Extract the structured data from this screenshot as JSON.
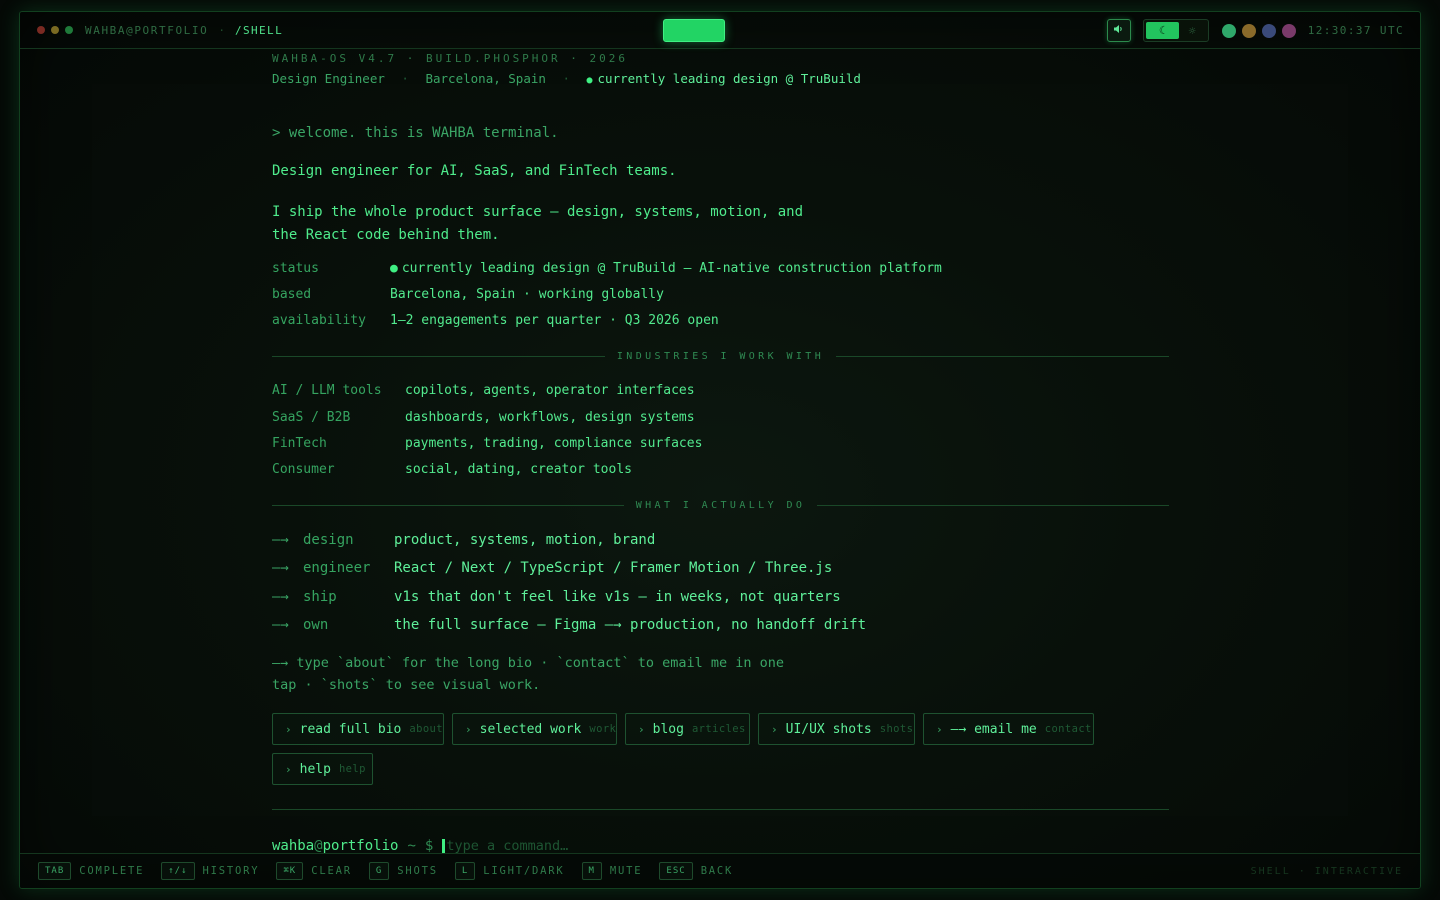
{
  "topbar": {
    "host": "WAHBA@PORTFOLIO",
    "separator": "·",
    "path": "/SHELL",
    "sound_icon": "speaker-icon",
    "theme_dark_icon": "moon-icon",
    "theme_light_icon": "sun-icon",
    "swatches": [
      "#2fa86a",
      "#8a6a2a",
      "#3a4a7a",
      "#7a3a6a"
    ],
    "clock": "12:30:37 UTC"
  },
  "header": {
    "banner": "WAHBA-OS V4.7 · BUILD.PHOSPHOR · 2026",
    "role": "Design Engineer",
    "dot1": "·",
    "location": "Barcelona, Spain",
    "dot2": "·",
    "status_bullet": "●",
    "status": "currently leading design @ TruBuild"
  },
  "intro": {
    "welcome": "> welcome. this is WAHBA terminal.",
    "headline": "Design engineer for AI, SaaS, and FinTech teams.",
    "pitch": "I ship the whole product surface — design, systems, motion, and the React code behind them."
  },
  "facts": [
    {
      "key": "status",
      "bullet": "●",
      "value": "currently leading design @ TruBuild — AI-native construction platform"
    },
    {
      "key": "based",
      "bullet": "",
      "value": "Barcelona, Spain · working globally"
    },
    {
      "key": "availability",
      "bullet": "",
      "value": "1–2 engagements per quarter · Q3 2026 open"
    }
  ],
  "industries": {
    "title": "INDUSTRIES I WORK WITH",
    "items": [
      {
        "key": "AI / LLM tools",
        "value": "copilots, agents, operator interfaces"
      },
      {
        "key": "SaaS / B2B",
        "value": "dashboards, workflows, design systems"
      },
      {
        "key": "FinTech",
        "value": "payments, trading, compliance surfaces"
      },
      {
        "key": "Consumer",
        "value": "social, dating, creator tools"
      }
    ]
  },
  "doing": {
    "title": "WHAT I ACTUALLY DO",
    "arrow": "—→",
    "items": [
      {
        "key": "design",
        "value": "product, systems, motion, brand"
      },
      {
        "key": "engineer",
        "value": "React / Next / TypeScript / Framer Motion / Three.js"
      },
      {
        "key": "ship",
        "value": "v1s that don't feel like v1s — in weeks, not quarters"
      },
      {
        "key": "own",
        "value": "the full surface — Figma —→ production, no handoff drift"
      }
    ]
  },
  "hint": "—→ type `about` for the long bio · `contact` to email me in one tap · `shots` to see visual work.",
  "chips": [
    {
      "caret": "›",
      "label": "read full bio",
      "cmd": "about"
    },
    {
      "caret": "›",
      "label": "selected work",
      "cmd": "work"
    },
    {
      "caret": "›",
      "label": "blog",
      "cmd": "articles"
    },
    {
      "caret": "›",
      "label": "UI/UX shots",
      "cmd": "shots"
    },
    {
      "caret": "›",
      "label": "—→ email me",
      "cmd": "contact"
    },
    {
      "caret": "›",
      "label": "help",
      "cmd": "help"
    }
  ],
  "prompt": {
    "user": "wahba",
    "at": "@",
    "host": "portfolio",
    "tilde": "~",
    "dollar": "$",
    "placeholder": "type a command…"
  },
  "bottombar": {
    "shortcuts": [
      {
        "key": "TAB",
        "label": "COMPLETE"
      },
      {
        "key": "↑/↓",
        "label": "HISTORY"
      },
      {
        "key": "⌘K",
        "label": "CLEAR"
      },
      {
        "key": "G",
        "label": "SHOTS"
      },
      {
        "key": "L",
        "label": "LIGHT/DARK"
      },
      {
        "key": "M",
        "label": "MUTE"
      },
      {
        "key": "ESC",
        "label": "BACK"
      }
    ],
    "mode": "SHELL · INTERACTIVE"
  }
}
